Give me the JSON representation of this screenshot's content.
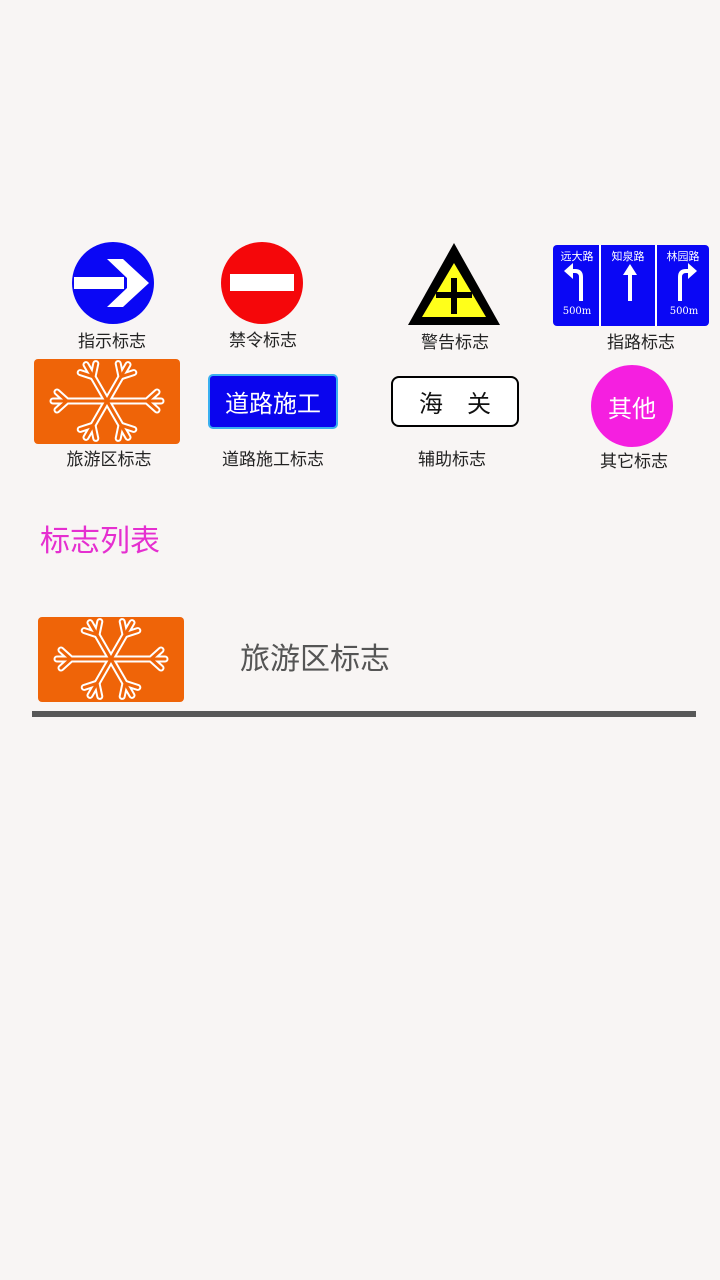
{
  "categories": {
    "indication": {
      "label": "指示标志",
      "icon": "right-arrow-icon",
      "color": "#0a07f5"
    },
    "prohibition": {
      "label": "禁令标志",
      "icon": "no-entry-icon",
      "color": "#f5070a"
    },
    "warning": {
      "label": "警告标志",
      "icon": "crossroad-warning-icon",
      "color": "#ffff1a"
    },
    "direction": {
      "label": "指路标志",
      "color": "#0a07f5",
      "lanes": [
        {
          "road": "远大路",
          "distance": "500m",
          "icon": "turn-left-arrow-icon"
        },
        {
          "road": "知泉路",
          "distance": "",
          "icon": "straight-arrow-icon"
        },
        {
          "road": "林园路",
          "distance": "500m",
          "icon": "turn-right-arrow-icon"
        }
      ]
    },
    "tourist": {
      "label": "旅游区标志",
      "icon": "snowflake-icon",
      "color": "#ef6408"
    },
    "road_work": {
      "label": "道路施工标志",
      "sign_text": "道路施工",
      "color": "#0a05ee"
    },
    "auxiliary": {
      "label": "辅助标志",
      "sign_text": "海　关"
    },
    "other": {
      "label": "其它标志",
      "sign_text": "其他",
      "color": "#f51fe0"
    }
  },
  "list": {
    "title": "标志列表",
    "items": [
      {
        "label": "旅游区标志",
        "icon": "snowflake-icon"
      }
    ]
  }
}
